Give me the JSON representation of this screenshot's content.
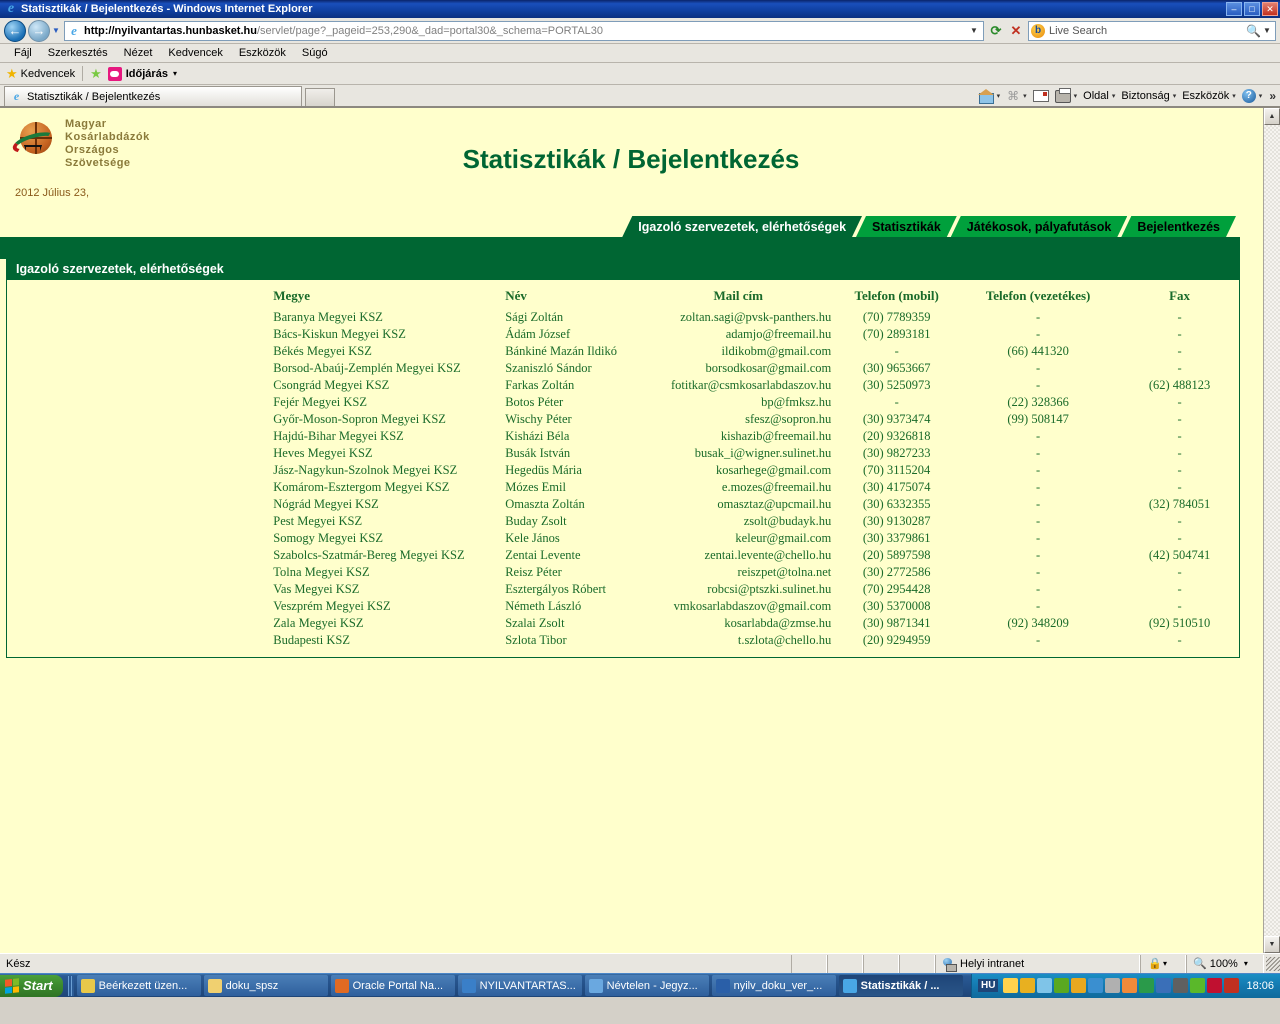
{
  "window": {
    "title": "Statisztikák / Bejelentkezés - Windows Internet Explorer",
    "minimize": "–",
    "maximize": "□",
    "close": "✕"
  },
  "address": {
    "url_bold": "http://nyilvantartas.hunbasket.hu",
    "url_dim": "/servlet/page?_pageid=253,290&_dad=portal30&_schema=PORTAL30",
    "dropdown": "▼",
    "refresh_icon": "refresh-icon",
    "stop_icon": "stop-icon"
  },
  "search": {
    "placeholder": "Live Search",
    "provider_icon": "bing-icon",
    "go_icon": "magnifier-icon",
    "dropdown": "▼"
  },
  "menubar": {
    "items": [
      "Fájl",
      "Szerkesztés",
      "Nézet",
      "Kedvencek",
      "Eszközök",
      "Súgó"
    ]
  },
  "favbar": {
    "favorites_label": "Kedvencek",
    "weather_label": "Időjárás",
    "weather_arrow": "▾"
  },
  "tabstrip": {
    "tab_label": "Statisztikák / Bejelentkezés"
  },
  "commandbar": {
    "items": [
      {
        "label": "",
        "icon": "home-icon",
        "arrow": "▾"
      },
      {
        "label": "",
        "icon": "rss-icon",
        "arrow": "▾"
      },
      {
        "label": "",
        "icon": "mail-icon",
        "arrow": ""
      },
      {
        "label": "",
        "icon": "print-icon",
        "arrow": "▾"
      },
      {
        "label": "Oldal",
        "icon": "",
        "arrow": "▾"
      },
      {
        "label": "Biztonság",
        "icon": "",
        "arrow": "▾"
      },
      {
        "label": "Eszközök",
        "icon": "",
        "arrow": "▾"
      },
      {
        "label": "",
        "icon": "help-icon",
        "arrow": "▾"
      }
    ],
    "overflow": "»"
  },
  "page": {
    "logo": {
      "line1": "Magyar",
      "line2": "Kosárlabdázók",
      "line3": "Országos",
      "line4": "Szövetsége"
    },
    "date": "2012 Július 23,",
    "title": "Statisztikák / Bejelentkezés",
    "tabs": [
      {
        "label": "Igazoló szervezetek, elérhetőségek",
        "active": true
      },
      {
        "label": "Statisztikák",
        "active": false
      },
      {
        "label": "Játékosok, pályafutások",
        "active": false
      },
      {
        "label": "Bejelentkezés",
        "active": false
      }
    ],
    "panel_title": "Igazoló szervezetek, elérhetőségek",
    "table": {
      "columns": [
        "Megye",
        "Név",
        "Mail cím",
        "Telefon (mobil)",
        "Telefon (vezetékes)",
        "Fax"
      ],
      "rows": [
        [
          "Baranya Megyei KSZ",
          "Sági Zoltán",
          "zoltan.sagi@pvsk-panthers.hu",
          "(70) 7789359",
          "-",
          "-"
        ],
        [
          "Bács-Kiskun Megyei KSZ",
          "Ádám József",
          "adamjo@freemail.hu",
          "(70) 2893181",
          "-",
          "-"
        ],
        [
          "Békés Megyei KSZ",
          "Bánkiné Mazán Ildikó",
          "ildikobm@gmail.com",
          "-",
          "(66) 441320",
          "-"
        ],
        [
          "Borsod-Abaúj-Zemplén Megyei KSZ",
          "Szaniszló Sándor",
          "borsodkosar@gmail.com",
          "(30) 9653667",
          "-",
          "-"
        ],
        [
          "Csongrád Megyei KSZ",
          "Farkas Zoltán",
          "fotitkar@csmkosarlabdaszov.hu",
          "(30) 5250973",
          "-",
          "(62) 488123"
        ],
        [
          "Fejér Megyei KSZ",
          "Botos Péter",
          "bp@fmksz.hu",
          "-",
          "(22) 328366",
          "-"
        ],
        [
          "Győr-Moson-Sopron Megyei KSZ",
          "Wischy Péter",
          "sfesz@sopron.hu",
          "(30) 9373474",
          "(99) 508147",
          "-"
        ],
        [
          "Hajdú-Bihar Megyei KSZ",
          "Kisházi Béla",
          "kishazib@freemail.hu",
          "(20) 9326818",
          "-",
          "-"
        ],
        [
          "Heves Megyei KSZ",
          "Busák István",
          "busak_i@wigner.sulinet.hu",
          "(30) 9827233",
          "-",
          "-"
        ],
        [
          "Jász-Nagykun-Szolnok Megyei KSZ",
          "Hegedüs Mária",
          "kosarhege@gmail.com",
          "(70) 3115204",
          "-",
          "-"
        ],
        [
          "Komárom-Esztergom Megyei KSZ",
          "Mózes Emil",
          "e.mozes@freemail.hu",
          "(30) 4175074",
          "-",
          "-"
        ],
        [
          "Nógrád Megyei KSZ",
          "Omaszta Zoltán",
          "omasztaz@upcmail.hu",
          "(30) 6332355",
          "-",
          "(32) 784051"
        ],
        [
          "Pest Megyei KSZ",
          "Buday Zsolt",
          "zsolt@budayk.hu",
          "(30) 9130287",
          "-",
          "-"
        ],
        [
          "Somogy Megyei KSZ",
          "Kele János",
          "keleur@gmail.com",
          "(30) 3379861",
          "-",
          "-"
        ],
        [
          "Szabolcs-Szatmár-Bereg Megyei KSZ",
          "Zentai Levente",
          "zentai.levente@chello.hu",
          "(20) 5897598",
          "-",
          "(42) 504741"
        ],
        [
          "Tolna Megyei KSZ",
          "Reisz Péter",
          "reiszpet@tolna.net",
          "(30) 2772586",
          "-",
          "-"
        ],
        [
          "Vas Megyei KSZ",
          "Esztergályos Róbert",
          "robcsi@ptszki.sulinet.hu",
          "(70) 2954428",
          "-",
          "-"
        ],
        [
          "Veszprém Megyei KSZ",
          "Németh László",
          "vmkosarlabdaszov@gmail.com",
          "(30) 5370008",
          "-",
          "-"
        ],
        [
          "Zala Megyei KSZ",
          "Szalai Zsolt",
          "kosarlabda@zmse.hu",
          "(30) 9871341",
          "(92) 348209",
          "(92) 510510"
        ],
        [
          "Budapesti KSZ",
          "Szlota Tibor",
          "t.szlota@chello.hu",
          "(20) 9294959",
          "-",
          "-"
        ]
      ]
    }
  },
  "statusbar": {
    "text": "Kész",
    "zone": "Helyi intranet",
    "zoom": "100%",
    "zoom_arrow": "▾",
    "protect_arrow": "▾"
  },
  "taskbar": {
    "start_label": "Start",
    "items": [
      {
        "label": "Beérkezett üzen...",
        "icon_color": "#e8c84a",
        "active": false
      },
      {
        "label": "doku_spsz",
        "icon_color": "#f0d070",
        "active": false
      },
      {
        "label": "Oracle Portal Na...",
        "icon_color": "#e06a22",
        "active": false
      },
      {
        "label": "NYILVANTARTAS...",
        "icon_color": "#3a7fc8",
        "active": false
      },
      {
        "label": "Névtelen - Jegyz...",
        "icon_color": "#6aa8e0",
        "active": false
      },
      {
        "label": "nyilv_doku_ver_...",
        "icon_color": "#2a5fa8",
        "active": false
      },
      {
        "label": "Statisztikák / ...",
        "icon_color": "#49a7e6",
        "active": true
      }
    ],
    "lang": "HU",
    "clock": "18:06",
    "tray_icons": [
      {
        "name": "mail-tray-icon",
        "color": "#ffd24d"
      },
      {
        "name": "shield-tray-icon",
        "color": "#e8b020"
      },
      {
        "name": "search-tray-icon",
        "color": "#7fc4e8"
      },
      {
        "name": "ovi-tray-icon",
        "color": "#5aa820"
      },
      {
        "name": "security-tray-icon",
        "color": "#e8a820"
      },
      {
        "name": "messenger-tray-icon",
        "color": "#3a8fd0"
      },
      {
        "name": "pen-tray-icon",
        "color": "#b0b0b0"
      },
      {
        "name": "calc-tray-icon",
        "color": "#f08a3a"
      },
      {
        "name": "network-tray-icon",
        "color": "#2a9a4a"
      },
      {
        "name": "connection-tray-icon",
        "color": "#3a6fb8"
      },
      {
        "name": "disc-tray-icon",
        "color": "#606060"
      },
      {
        "name": "update-tray-icon",
        "color": "#5ab82a"
      },
      {
        "name": "opera-tray-icon",
        "color": "#c01030"
      },
      {
        "name": "error-tray-icon",
        "color": "#c03020"
      }
    ]
  }
}
